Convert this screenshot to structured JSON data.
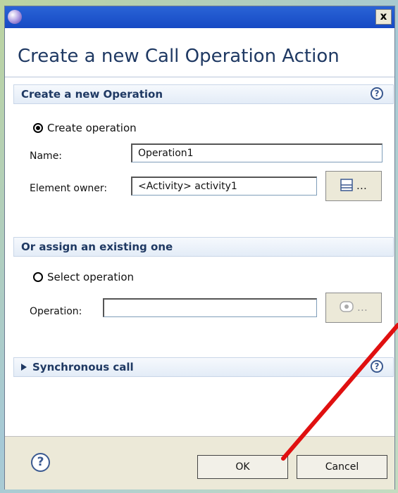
{
  "window": {
    "title_text": "",
    "close_symbol": "x"
  },
  "dialog": {
    "title": "Create a new Call Operation Action"
  },
  "create_section": {
    "header": "Create a new Operation",
    "help_symbol": "?",
    "radio_label": "Create operation",
    "radio_checked": true,
    "name_label": "Name:",
    "name_value": "Operation1",
    "owner_label": "Element owner:",
    "owner_value": "<Activity> activity1",
    "browse_label": "…"
  },
  "assign_section": {
    "header": "Or assign an existing one",
    "radio_label": "Select operation",
    "radio_checked": false,
    "operation_label": "Operation:",
    "operation_value": "",
    "browse_label": "…"
  },
  "sync_section": {
    "header": "Synchronous call",
    "help_symbol": "?"
  },
  "footer": {
    "help_symbol": "?",
    "ok_label": "OK",
    "cancel_label": "Cancel"
  },
  "icons": {
    "app": "eclipse-icon",
    "close": "close-icon",
    "help": "help-icon",
    "browse": "list-icon",
    "browse_disabled": "operation-icon",
    "expand": "triangle-right-icon"
  },
  "colors": {
    "title_bar": "#1649c4",
    "title_text": "#1f3963",
    "footer_bg": "#ece9d8",
    "annotation_arrow": "#e01010"
  }
}
